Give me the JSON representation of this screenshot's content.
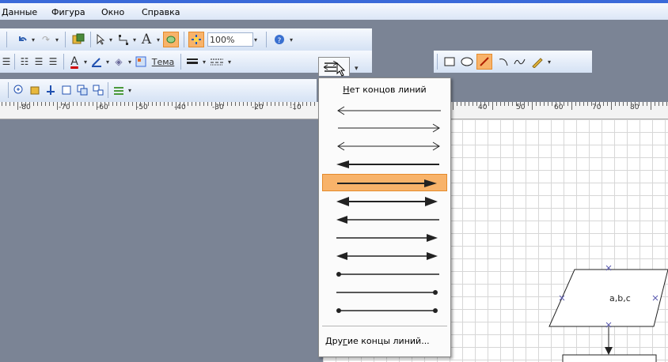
{
  "menu": {
    "items": [
      {
        "label": "Данные"
      },
      {
        "label": "Фигура"
      },
      {
        "label": "Окно"
      },
      {
        "label": "Справка"
      }
    ]
  },
  "toolbar1": {
    "zoom_value": "100%",
    "text_tool": "A"
  },
  "toolbar2": {
    "font_color_label": "A",
    "theme_label": "Тема"
  },
  "ruler": {
    "labels": [
      "-80",
      "-70",
      "-60",
      "-50",
      "-40",
      "-30",
      "-20",
      "-10",
      "40",
      "50",
      "60",
      "70",
      "80"
    ]
  },
  "dropdown": {
    "no_ends_label": "Нет концов линий",
    "no_ends_accel": "Н",
    "no_ends_rest": "ет концов линий",
    "more_label": "Другие концы линий...",
    "more_before": "Дру",
    "more_accel": "г",
    "more_after": "ие концы линий...",
    "selected_index": 4,
    "styles": [
      "left-open",
      "right-open",
      "both-open",
      "left-filled",
      "right-filled",
      "both-filled",
      "left-filled-2",
      "right-filled-2",
      "both-filled-2",
      "left-dot",
      "right-dot",
      "both-dot"
    ]
  },
  "diagram": {
    "io_shape_label": "a,b,c"
  },
  "colors": {
    "highlight": "#f8b36a",
    "titlebar": "#3a6ad9",
    "canvas": "#7b8495"
  }
}
